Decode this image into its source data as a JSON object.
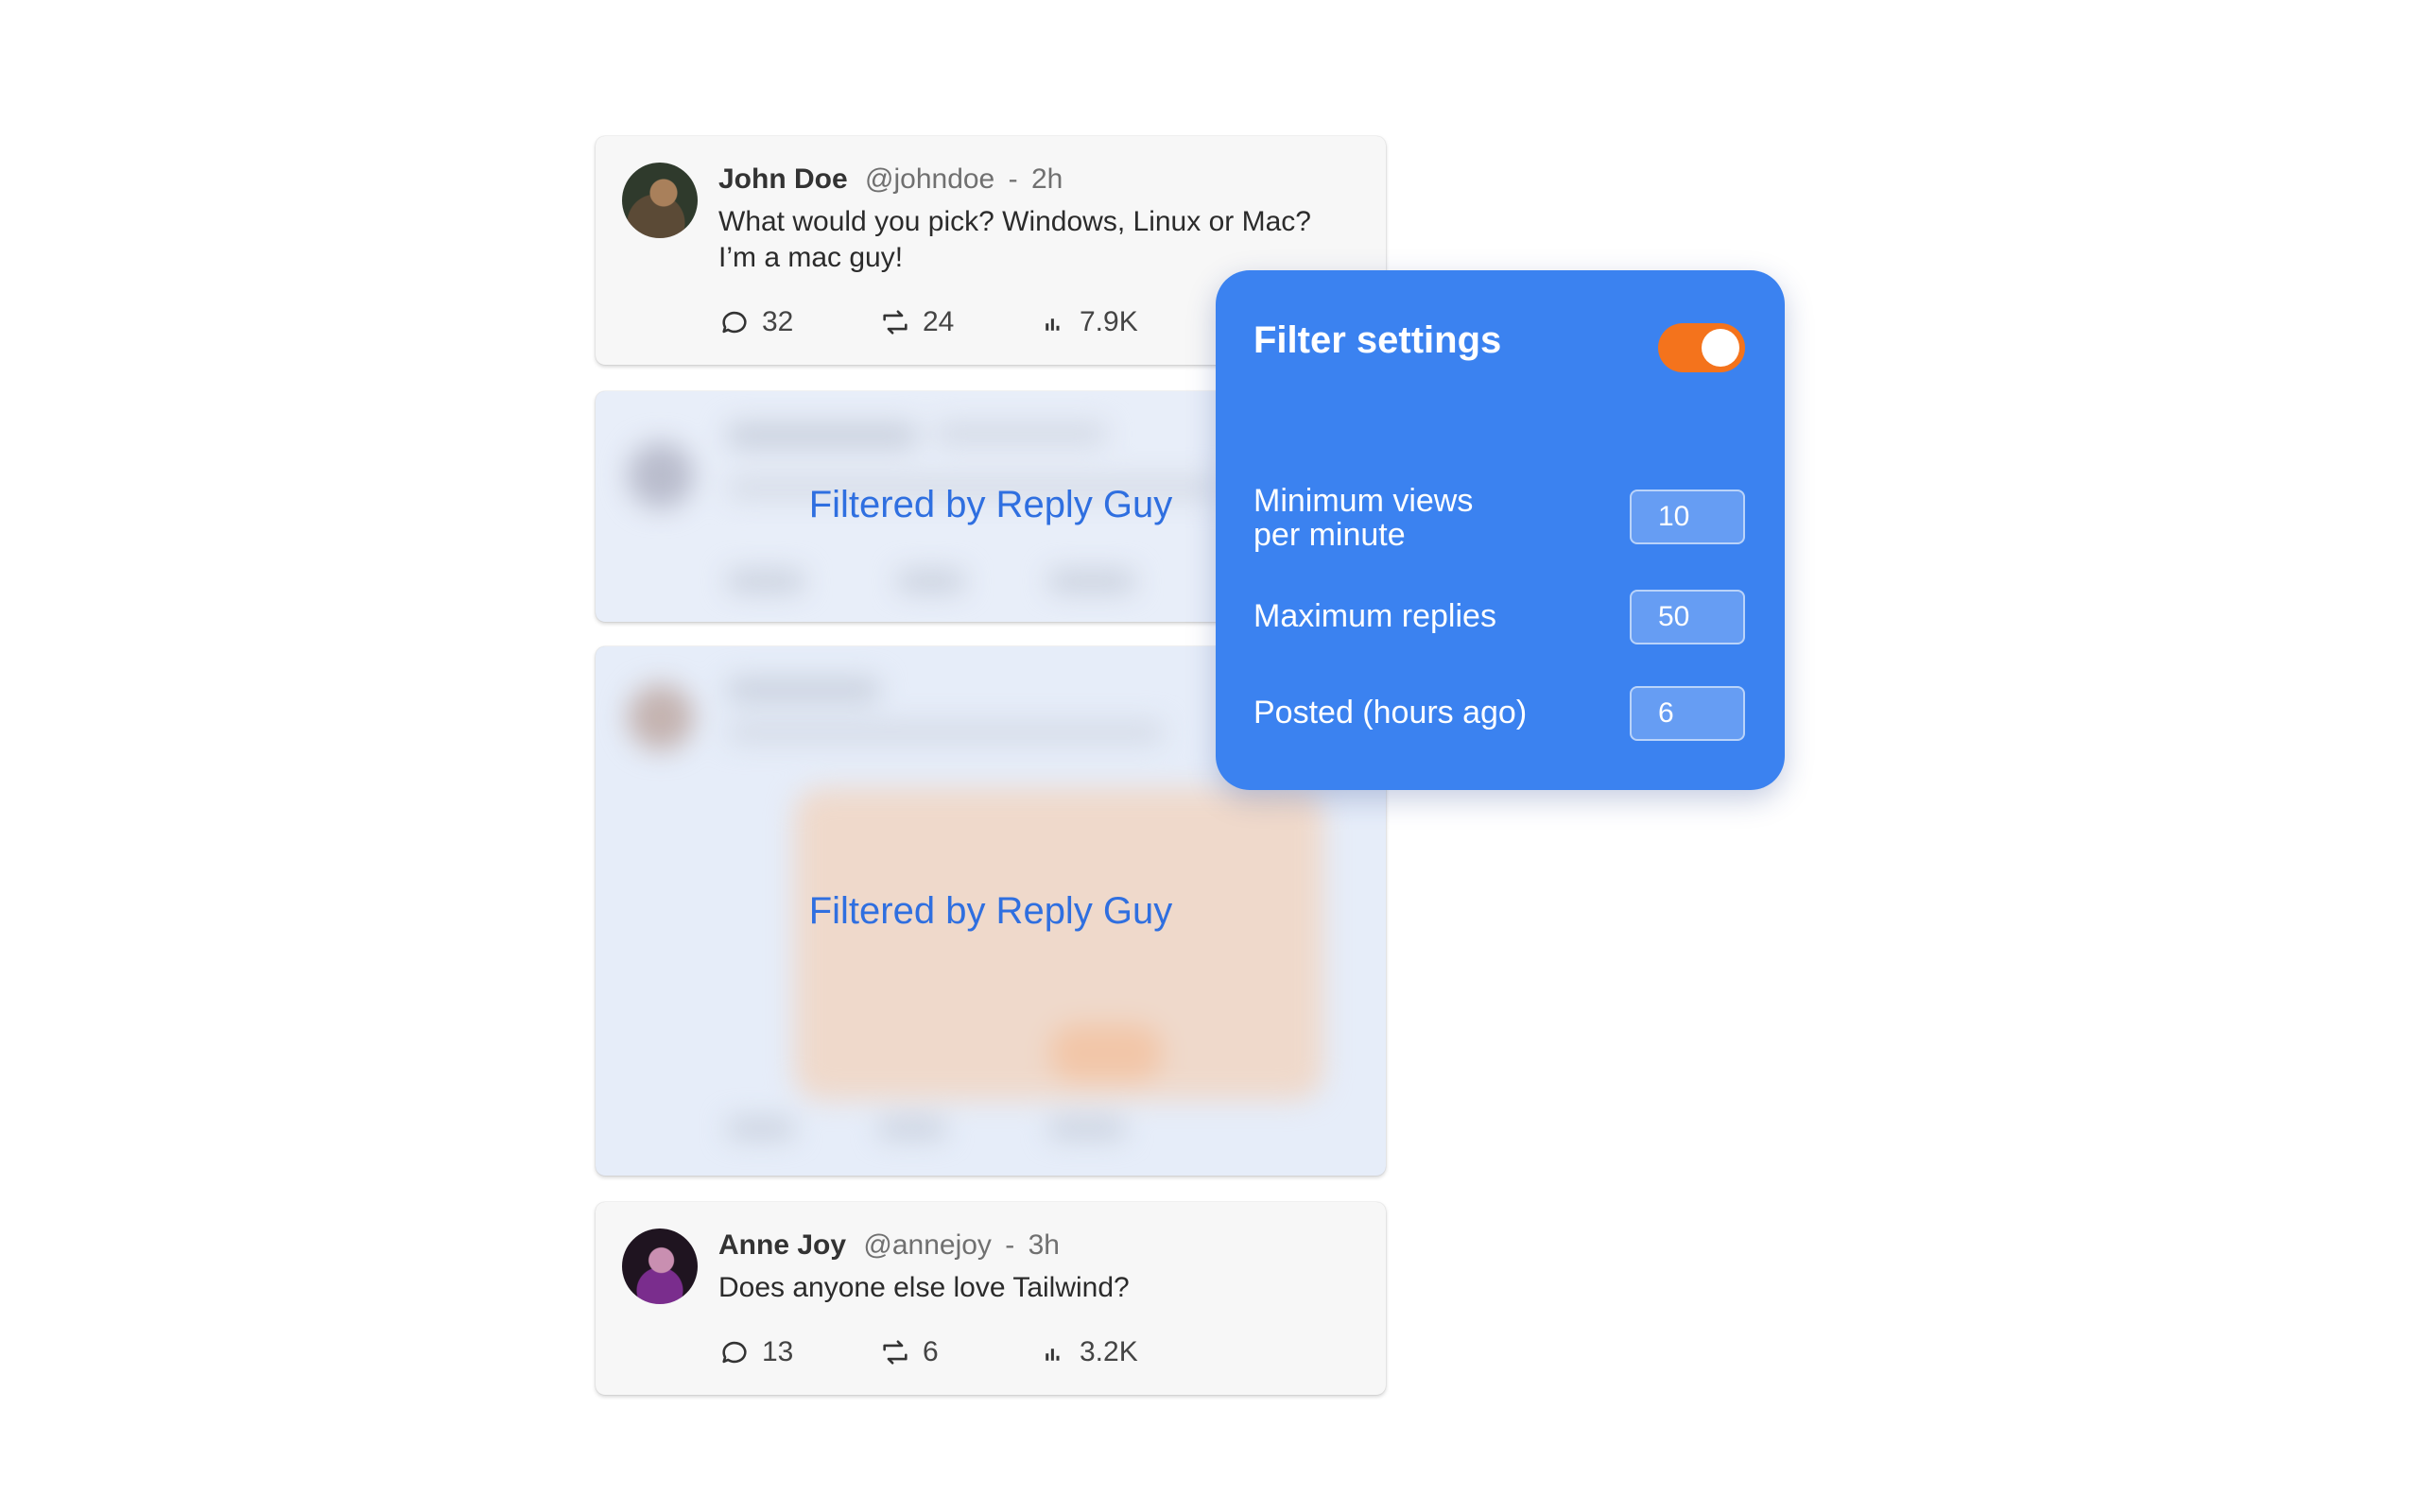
{
  "tweets": [
    {
      "name": "John Doe",
      "handle": "@johndoe",
      "separator": "-",
      "time": "2h",
      "text_line1": "What would you pick? Windows, Linux or Mac?",
      "text_line2": "I’m a mac guy!",
      "replies": "32",
      "retweets": "24",
      "views": "7.9K"
    },
    {
      "filtered_label": "Filtered by Reply Guy"
    },
    {
      "filtered_label": "Filtered by Reply Guy"
    },
    {
      "name": "Anne Joy",
      "handle": "@annejoy",
      "separator": "-",
      "time": "3h",
      "text_line1": "Does anyone else love Tailwind?",
      "replies": "13",
      "retweets": "6",
      "views": "3.2K"
    }
  ],
  "filter_panel": {
    "title": "Filter settings",
    "enabled": true,
    "toggle_color": "#f4731c",
    "panel_color": "#3b82f0",
    "fields": [
      {
        "label_line1": "Minimum views",
        "label_line2": "per minute",
        "value": "10"
      },
      {
        "label": "Maximum replies",
        "value": "50"
      },
      {
        "label": "Posted (hours ago)",
        "value": "6"
      }
    ]
  }
}
